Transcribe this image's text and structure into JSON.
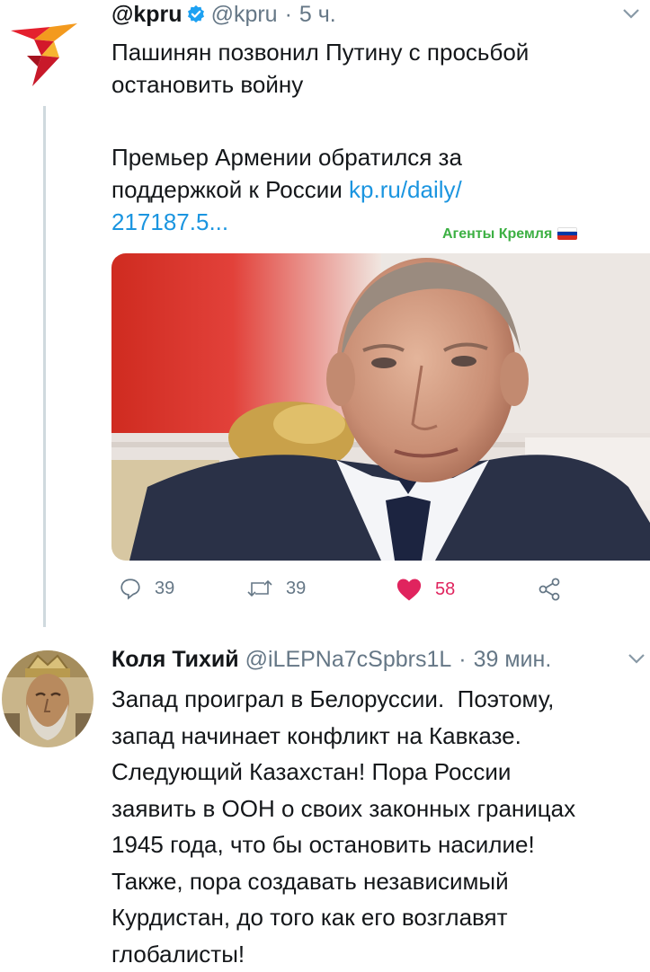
{
  "tweet1": {
    "display_name": "@kpru",
    "handle": "@kpru",
    "separator": "·",
    "time": "5 ч.",
    "text_line1": "Пашинян позвонил Путину с просьбой\nостановить войну",
    "text_line2": "Премьер Армении обратился за\nподдержкой к России ",
    "link_text": "kp.ru/daily/\n217187.5...",
    "actions": {
      "reply_count": "39",
      "retweet_count": "39",
      "like_count": "58"
    }
  },
  "watermark": {
    "text": "Агенты Кремля"
  },
  "tweet2": {
    "display_name": "Коля Тихий",
    "handle": "@iLEPNa7cSpbrs1L",
    "separator": "·",
    "time": "39 мин.",
    "text": "Запад проиграл в Белоруссии.  Поэтому,\nзапад начинает конфликт на Кавказе.\nСледующий Казахстан! Пора России\nзаявить в ООН о своих законных границах\n1945 года, что бы остановить насилие!\nТакже, пора создавать независимый\nКурдистан, до того как его возглавят\nглобалисты!"
  },
  "icons": {
    "caret": "chevron-down-icon",
    "verified": "verified-badge-icon",
    "reply": "reply-icon",
    "retweet": "retweet-icon",
    "like": "heart-icon",
    "share": "share-icon"
  },
  "colors": {
    "link": "#1b95e0",
    "like": "#e0245e",
    "muted": "#657786",
    "watermark": "#3cb043",
    "verified": "#1da1f2"
  }
}
